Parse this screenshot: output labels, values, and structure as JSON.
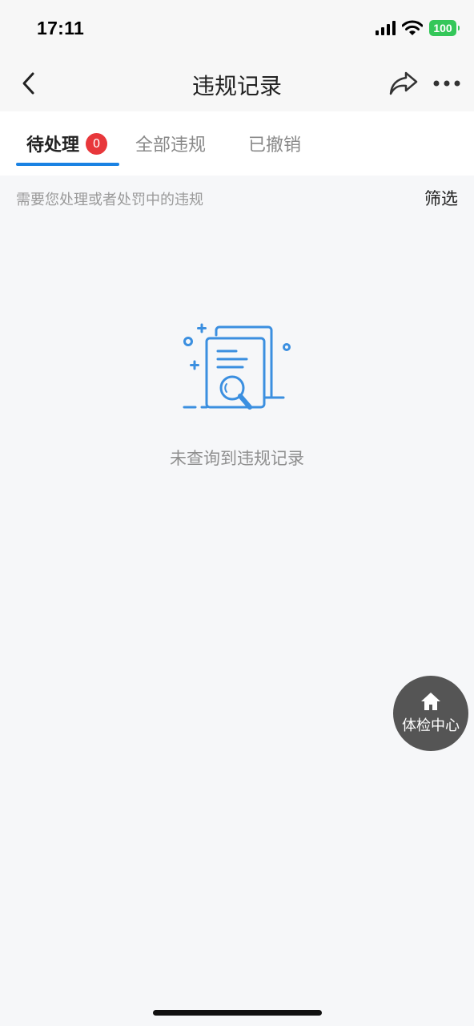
{
  "status_bar": {
    "time": "17:11",
    "battery": "100",
    "battery_color": "#34c759",
    "icons": [
      "signal-icon",
      "wifi-icon",
      "battery-icon"
    ]
  },
  "nav": {
    "title": "违规记录",
    "back_icon": "chevron-left-icon",
    "share_icon": "share-icon",
    "more_icon": "more-dots-icon"
  },
  "tabs": [
    {
      "label": "待处理",
      "badge": "0",
      "active": true
    },
    {
      "label": "全部违规",
      "active": false
    },
    {
      "label": "已撤销",
      "active": false
    }
  ],
  "subheader": {
    "hint": "需要您处理或者处罚中的违规",
    "filter_label": "筛选"
  },
  "empty_state": {
    "icon": "document-search-icon",
    "message": "未查询到违规记录"
  },
  "float_button": {
    "icon": "home-icon",
    "label": "体检中心"
  },
  "colors": {
    "accent": "#1a82e3",
    "badge": "#e8373b",
    "background": "#f6f7f9"
  }
}
